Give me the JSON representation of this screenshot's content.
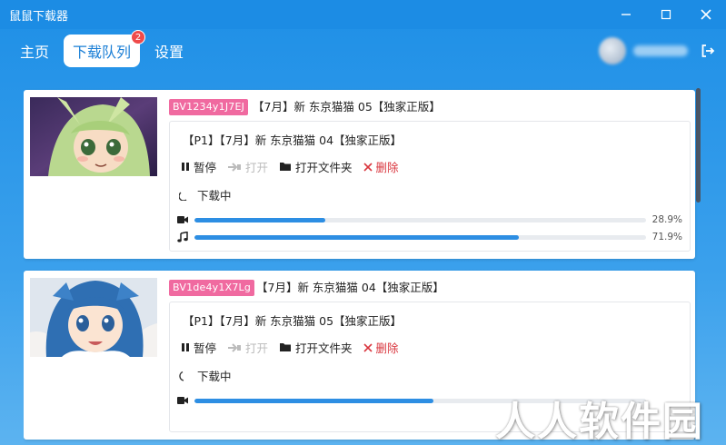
{
  "app": {
    "title": "鼠鼠下载器"
  },
  "nav": {
    "items": [
      {
        "label": "主页"
      },
      {
        "label": "下载队列",
        "badge": "2"
      },
      {
        "label": "设置"
      }
    ]
  },
  "colors": {
    "accent": "#1c8ce4",
    "bv_tag": "#f06aa0",
    "progress": "#2d8ee3",
    "danger": "#d9363e"
  },
  "cards": [
    {
      "bv": "BV1234y1J7EJ",
      "title": "【7月】新 东京猫猫 05【独家正版】",
      "task_title": "【P1】【7月】新 东京猫猫 04【独家正版】",
      "actions": {
        "pause": "暂停",
        "open": "打开",
        "open_folder": "打开文件夹",
        "delete": "删除"
      },
      "status": "下载中",
      "video_progress": 0.289,
      "video_pct": "28.9%",
      "audio_progress": 0.719,
      "audio_pct": "71.9%"
    },
    {
      "bv": "BV1de4y1X7Lg",
      "title": "【7月】新 东京猫猫 04【独家正版】",
      "task_title": "【P1】【7月】新 东京猫猫 05【独家正版】",
      "actions": {
        "pause": "暂停",
        "open": "打开",
        "open_folder": "打开文件夹",
        "delete": "删除"
      },
      "status": "下载中",
      "video_progress": 0.53
    }
  ],
  "watermark": "人人软件园"
}
